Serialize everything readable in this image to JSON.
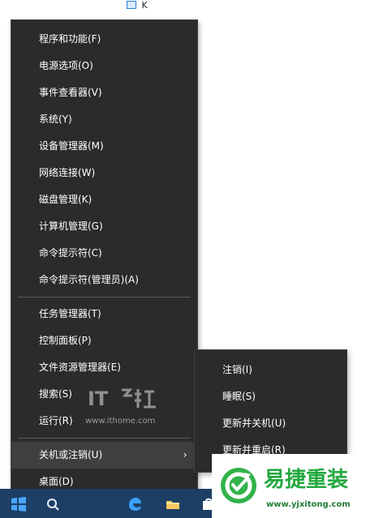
{
  "top_file": {
    "label": "K"
  },
  "menu": {
    "items": [
      {
        "label": "程序和功能(F)"
      },
      {
        "label": "电源选项(O)"
      },
      {
        "label": "事件查看器(V)"
      },
      {
        "label": "系统(Y)"
      },
      {
        "label": "设备管理器(M)"
      },
      {
        "label": "网络连接(W)"
      },
      {
        "label": "磁盘管理(K)"
      },
      {
        "label": "计算机管理(G)"
      },
      {
        "label": "命令提示符(C)"
      },
      {
        "label": "命令提示符(管理员)(A)"
      },
      {
        "label": "任务管理器(T)"
      },
      {
        "label": "控制面板(P)"
      },
      {
        "label": "文件资源管理器(E)"
      },
      {
        "label": "搜索(S)"
      },
      {
        "label": "运行(R)"
      },
      {
        "label": "关机或注销(U)",
        "submenu_indicator": "›"
      },
      {
        "label": "桌面(D)"
      }
    ]
  },
  "submenu": {
    "items": [
      {
        "label": "注销(I)"
      },
      {
        "label": "睡眠(S)"
      },
      {
        "label": "更新并关机(U)"
      },
      {
        "label": "更新并重启(R)"
      }
    ]
  },
  "watermark": {
    "url": "www.ithome.com"
  },
  "brand": {
    "title": "易捷重装",
    "url": "www.yjxitong.com"
  },
  "colors": {
    "menu_background": "#2b2b2b",
    "menu_highlight": "#3f3f3f",
    "taskbar": "#1d3f66",
    "brand_green": "#22a83f"
  },
  "icons": {
    "start": "windows-start-icon",
    "search": "search-icon",
    "edge": "edge-browser-icon",
    "folder": "file-explorer-icon",
    "store": "store-icon",
    "brand": "brand-refresh-icon"
  }
}
